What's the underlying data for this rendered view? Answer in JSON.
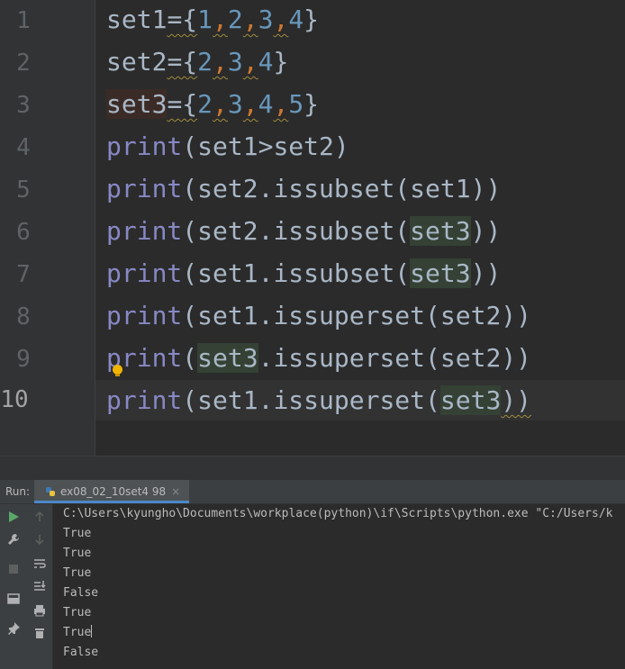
{
  "editor": {
    "line_numbers": [
      "1",
      "2",
      "3",
      "4",
      "5",
      "6",
      "7",
      "8",
      "9",
      "10"
    ],
    "lines": [
      {
        "t1": "set1",
        "t2": "={",
        "n1": "1",
        "n2": "2",
        "n3": "3",
        "n4": "4",
        "t3": "}"
      },
      {
        "t1": "set2",
        "t2": "={",
        "n1": "2",
        "n2": "3",
        "n3": "4",
        "t3": "}"
      },
      {
        "t1": "set3",
        "t2": "={",
        "n1": "2",
        "n2": "3",
        "n3": "4",
        "n4": "5",
        "t3": "}"
      },
      {
        "kw": "print",
        "rest": "(set1>set2)"
      },
      {
        "kw": "print",
        "rest": "(set2.issubset(set1))"
      },
      {
        "kw": "print",
        "a": "(set2.issubset(",
        "hl": "set3",
        "b": "))"
      },
      {
        "kw": "print",
        "a": "(set1.issubset(",
        "hl": "set3",
        "b": "))"
      },
      {
        "kw": "print",
        "rest": "(set1.issuperset(set2))"
      },
      {
        "kw": "print",
        "a": "(",
        "hl": "set3",
        "b": ".issuperset(set2))"
      },
      {
        "kw": "print",
        "a": "(set1.issuperset(",
        "hl": "set3",
        "b": "))"
      }
    ],
    "comma": ","
  },
  "run": {
    "label": "Run:",
    "tab_label": "ex08_02_10set4 98",
    "tab_close": "×",
    "command": "C:\\Users\\kyungho\\Documents\\workplace(python)\\if\\Scripts\\python.exe \"C:/Users/k",
    "output": [
      "True",
      "True",
      "True",
      "False",
      "True",
      "True",
      "False"
    ]
  },
  "icons": [
    "rerun-icon",
    "wrench-icon",
    "stop-icon",
    "layout-icon",
    "pin-icon",
    "up-arrow-icon",
    "down-arrow-icon",
    "soft-wrap-icon",
    "scroll-to-end-icon",
    "print-icon",
    "trash-icon",
    "python-file-icon",
    "bulb-icon"
  ]
}
